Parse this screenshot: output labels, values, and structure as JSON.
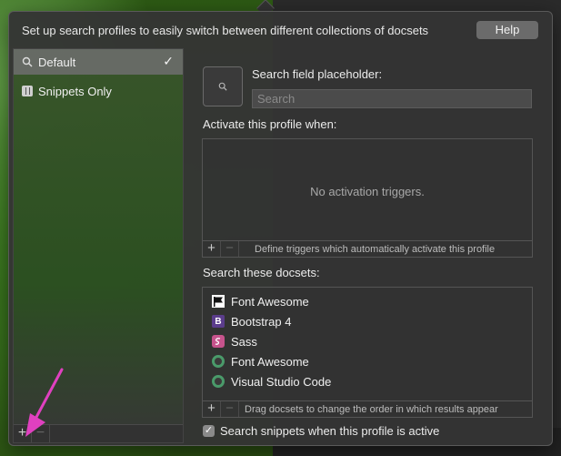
{
  "header": {
    "text": "Set up search profiles to easily switch between different collections of docsets",
    "help_label": "Help"
  },
  "sidebar": {
    "items": [
      {
        "label": "Default",
        "icon": "search-icon",
        "selected": true
      },
      {
        "label": "Snippets Only",
        "icon": "snippet-icon",
        "selected": false
      }
    ],
    "add_label": "+",
    "remove_label": "−"
  },
  "main": {
    "placeholder_label": "Search field placeholder:",
    "placeholder_value": "Search",
    "activate_label": "Activate this profile when:",
    "no_triggers": "No activation triggers.",
    "triggers_hint": "Define triggers which automatically activate this profile",
    "docsets_label": "Search these docsets:",
    "docsets": [
      {
        "label": "Font Awesome",
        "icon": "flag-icon"
      },
      {
        "label": "Bootstrap 4",
        "icon": "bootstrap-icon",
        "glyph": "B"
      },
      {
        "label": "Sass",
        "icon": "sass-icon"
      },
      {
        "label": "Font Awesome",
        "icon": "circle-icon"
      },
      {
        "label": "Visual Studio Code",
        "icon": "circle-icon"
      }
    ],
    "docsets_hint": "Drag docsets to change the order in which results appear",
    "snippets_label": "Search snippets when this profile is active",
    "snippets_checked": true
  },
  "colors": {
    "annotation_arrow": "#e040c0",
    "selection": "#6e6e6e"
  }
}
